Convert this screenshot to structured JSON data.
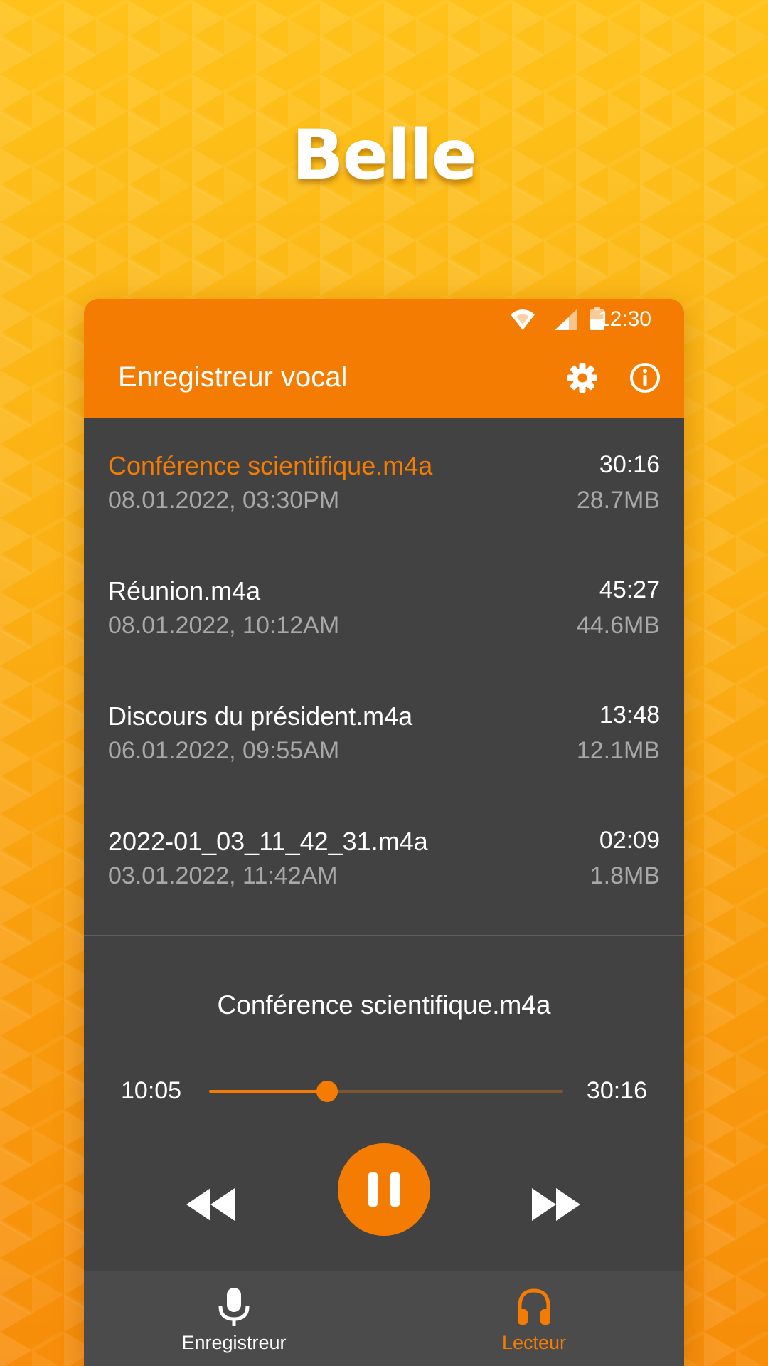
{
  "brand": {
    "title": "Belle"
  },
  "status_bar": {
    "time": "12:30"
  },
  "app_bar": {
    "title": "Enregistreur vocal",
    "icons": [
      "settings-icon",
      "info-icon"
    ]
  },
  "recordings": [
    {
      "name": "Conférence scientifique.m4a",
      "date": "08.01.2022, 03:30PM",
      "duration": "30:16",
      "size": "28.7MB",
      "active": true
    },
    {
      "name": "Réunion.m4a",
      "date": "08.01.2022, 10:12AM",
      "duration": "45:27",
      "size": "44.6MB",
      "active": false
    },
    {
      "name": "Discours du président.m4a",
      "date": "06.01.2022, 09:55AM",
      "duration": "13:48",
      "size": "12.1MB",
      "active": false
    },
    {
      "name": "2022-01_03_11_42_31.m4a",
      "date": "03.01.2022, 11:42AM",
      "duration": "02:09",
      "size": "1.8MB",
      "active": false
    }
  ],
  "player": {
    "now_playing": "Conférence scientifique.m4a",
    "elapsed": "10:05",
    "total": "30:16",
    "progress": 0.333,
    "state": "playing"
  },
  "bottom_nav": {
    "items": [
      {
        "label": "Enregistreur",
        "icon": "microphone-icon",
        "active": false
      },
      {
        "label": "Lecteur",
        "icon": "headphones-icon",
        "active": true
      }
    ]
  },
  "colors": {
    "accent": "#f57c02",
    "panel": "#424242",
    "nav": "#4b4b4b",
    "background": "#fbb114"
  }
}
